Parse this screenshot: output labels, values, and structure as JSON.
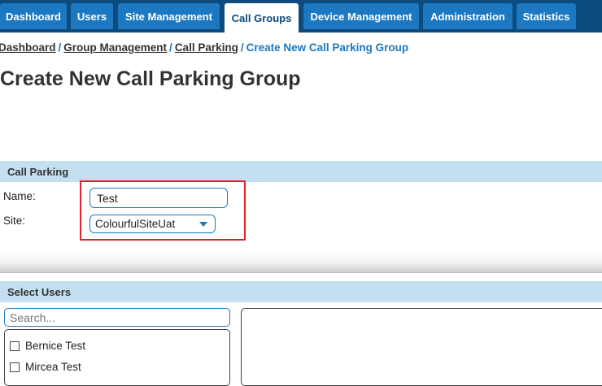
{
  "nav": {
    "tabs": [
      {
        "label": "Dashboard"
      },
      {
        "label": "Users"
      },
      {
        "label": "Site Management"
      },
      {
        "label": "Call Groups",
        "active": true
      },
      {
        "label": "Device Management"
      },
      {
        "label": "Administration"
      },
      {
        "label": "Statistics"
      }
    ]
  },
  "breadcrumb": {
    "items": [
      "Dashboard",
      "Group Management",
      "Call Parking"
    ],
    "separator": "/",
    "current": "Create New Call Parking Group"
  },
  "page": {
    "title": "Create New Call Parking Group"
  },
  "call_parking": {
    "header": "Call Parking",
    "name_label": "Name:",
    "name_value": "Test",
    "site_label": "Site:",
    "site_value": "ColourfulSiteUat"
  },
  "select_users": {
    "header": "Select Users",
    "search_placeholder": "Search...",
    "users": [
      "Bernice Test",
      "Mircea Test"
    ]
  },
  "colors": {
    "nav_background": "#0d4a7d",
    "tab_background": "#1c78c0",
    "panel_header": "#c4dff0",
    "highlight": "#e0202a"
  }
}
